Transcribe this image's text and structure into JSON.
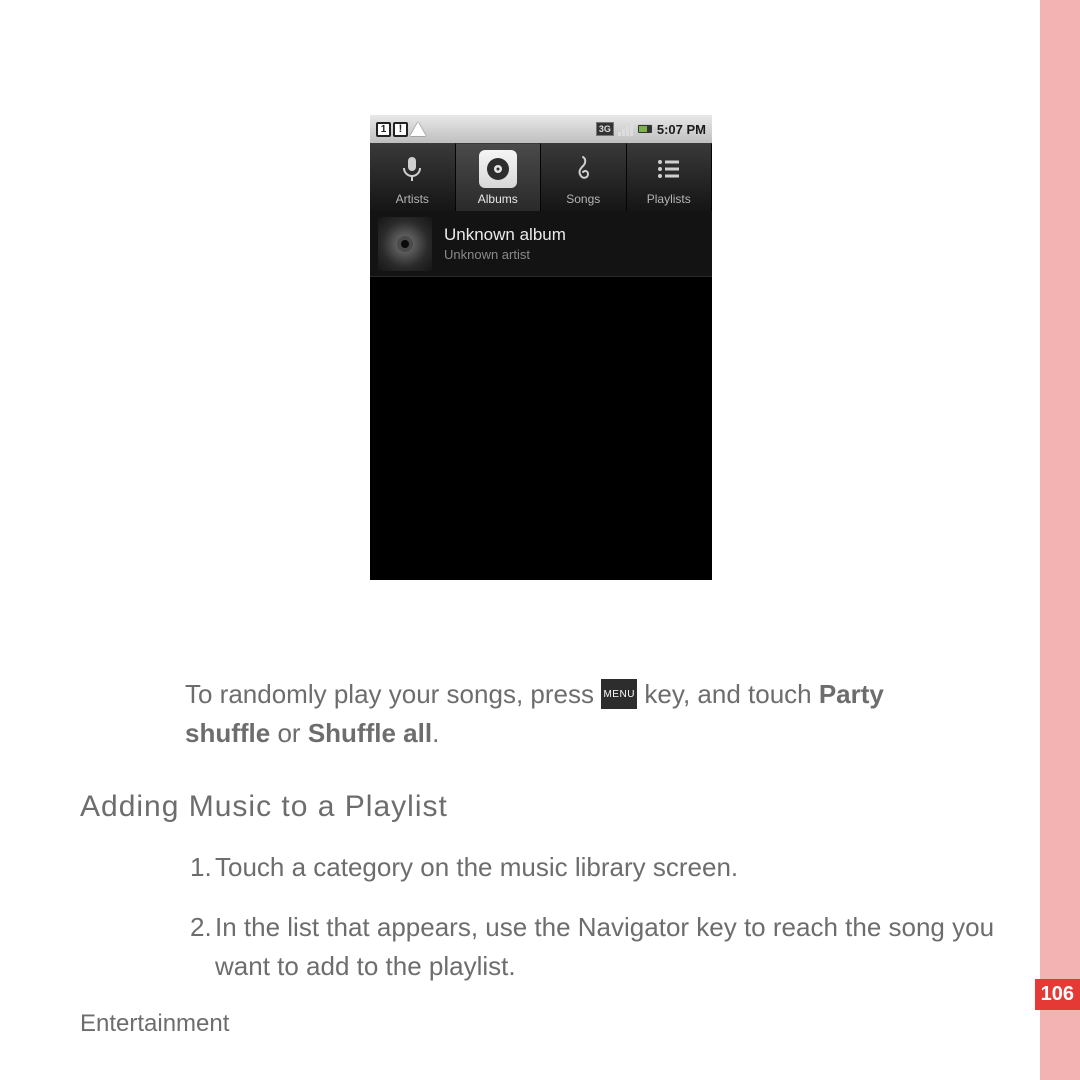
{
  "sidebar": {
    "page_number": "106"
  },
  "phone": {
    "statusbar": {
      "sim_label": "1",
      "time": "5:07 PM",
      "data_label": "3G"
    },
    "tabs": [
      {
        "label": "Artists"
      },
      {
        "label": "Albums"
      },
      {
        "label": "Songs"
      },
      {
        "label": "Playlists"
      }
    ],
    "album": {
      "title": "Unknown album",
      "artist": "Unknown artist"
    }
  },
  "doc": {
    "para1_a": "To randomly play your songs, press ",
    "para1_b": " key, and touch ",
    "party": "Party",
    "shuffle_line": "shuffle",
    "or_word": " or ",
    "shuffle_all": "Shuffle all",
    "period": ".",
    "menu_chip": "MENU",
    "heading": "Adding Music to a Playlist",
    "step1_num": "1. ",
    "step1": "Touch a category on the music library screen.",
    "step2_num": "2. ",
    "step2": "In the list that appears, use the Navigator key to reach the song you want to add to the playlist.",
    "footer": "Entertainment"
  }
}
